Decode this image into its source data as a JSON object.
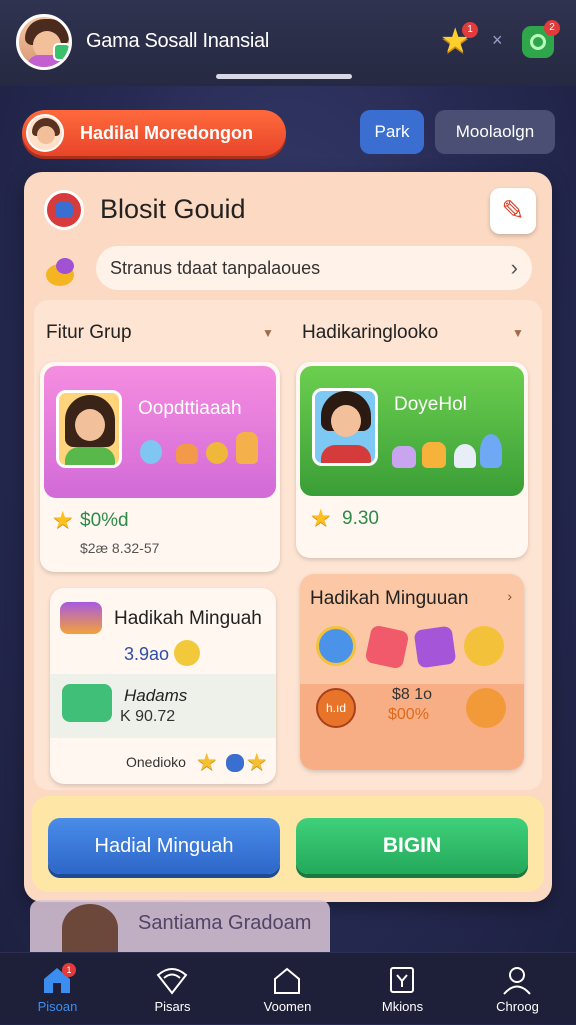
{
  "header": {
    "title": "Gama Sosall Inansial",
    "star_badge": "1",
    "close_glyph": "×",
    "green_badge": "2"
  },
  "top_row": {
    "promo_label": "Hadilal Moredongon",
    "park_button": "Park",
    "modal_button": "Moolaolgn"
  },
  "panel": {
    "title": "Blosit Gouid",
    "status_text": "Stranus tdaat tanpalaoues",
    "col_left": "Fitur Grup",
    "col_right": "Hadikaringlooko",
    "cards": {
      "pink": {
        "name": "Oopdttiaaah",
        "price": "$0%d",
        "price_sub": "$2æ 8.32-57"
      },
      "green": {
        "name": "DoyeHol",
        "price": "9.30"
      },
      "weekly": {
        "title": "Hadikah Minguah",
        "price": "3.9ao",
        "sub_title": "Hadams",
        "sub_value": "K 90.72",
        "footer": "Onedioko"
      },
      "weekly2": {
        "title": "Hadikah Minguuan",
        "value1": "$8 1o",
        "value2": "$00%",
        "tag": "h.ıd"
      }
    },
    "buttons": {
      "left": "Hadial Minguah",
      "right": "BIGIN"
    }
  },
  "peek": {
    "label": "Santiama Gradoam"
  },
  "nav": [
    {
      "label": "Pisoan",
      "icon": "home-icon",
      "badge": "1"
    },
    {
      "label": "Pisars",
      "icon": "wifi-icon"
    },
    {
      "label": "Voomen",
      "icon": "house-outline-icon"
    },
    {
      "label": "Mkions",
      "icon": "mission-icon"
    },
    {
      "label": "Chroog",
      "icon": "profile-icon"
    }
  ],
  "colors": {
    "accent_orange": "#e8452a",
    "accent_blue": "#3a6fd1",
    "accent_green": "#23a95a",
    "panel_bg": "#fbd9c2"
  }
}
